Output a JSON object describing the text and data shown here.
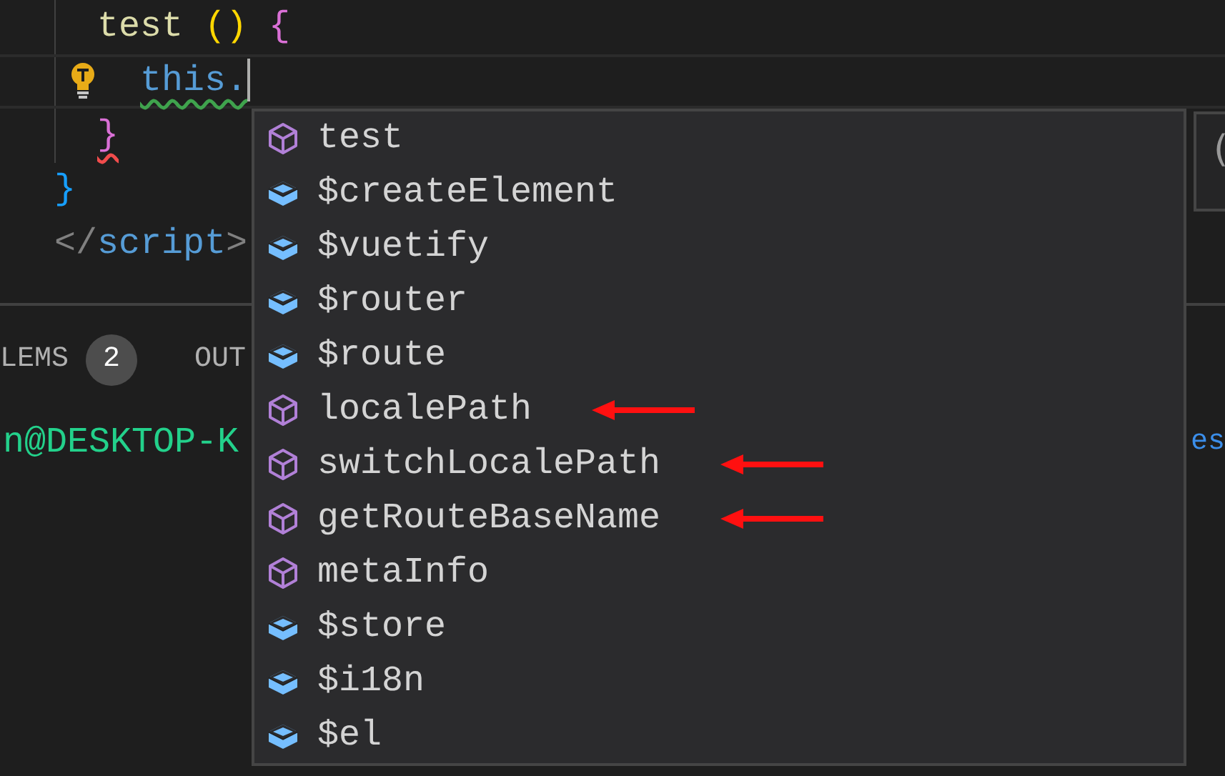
{
  "editor": {
    "lines": [
      {
        "children": [
          {
            "tokens": [
              {
                "text": "test",
                "kind": "function"
              },
              {
                "text": " ()",
                "kind": "bracket1"
              },
              {
                "text": " {",
                "kind": "bracket2"
              }
            ],
            "children": [
              {
                "current": true,
                "lightbulb": true,
                "cursor": true,
                "tokens": [
                  {
                    "text": "this.",
                    "kind": "keyword",
                    "warning": true
                  }
                ]
              }
            ]
          },
          {
            "tokens": [
              {
                "text": "}",
                "kind": "bracket2",
                "error": true
              }
            ]
          }
        ]
      },
      {
        "tokens": [
          {
            "text": "}",
            "kind": "bracket3"
          }
        ]
      },
      {
        "tokens": [
          {
            "text": "</",
            "kind": "tag"
          },
          {
            "text": "script",
            "kind": "keyword"
          },
          {
            "text": ">",
            "kind": "tag"
          }
        ]
      }
    ]
  },
  "panel": {
    "tabs": [
      {
        "label": "LEMS",
        "badge": "2"
      },
      {
        "label": "OUT"
      }
    ],
    "terminal": {
      "prompt": "n@DESKTOP-K",
      "right_text": "es"
    }
  },
  "suggestions": [
    {
      "label": "test",
      "kind": "property",
      "marked": false
    },
    {
      "label": "$createElement",
      "kind": "field",
      "marked": false
    },
    {
      "label": "$vuetify",
      "kind": "field",
      "marked": false
    },
    {
      "label": "$router",
      "kind": "field",
      "marked": false
    },
    {
      "label": "$route",
      "kind": "field",
      "marked": false
    },
    {
      "label": "localePath",
      "kind": "property",
      "marked": true
    },
    {
      "label": "switchLocalePath",
      "kind": "property",
      "marked": true
    },
    {
      "label": "getRouteBaseName",
      "kind": "property",
      "marked": true
    },
    {
      "label": "metaInfo",
      "kind": "property",
      "marked": false
    },
    {
      "label": "$store",
      "kind": "field",
      "marked": false
    },
    {
      "label": "$i18n",
      "kind": "field",
      "marked": false
    },
    {
      "label": "$el",
      "kind": "field",
      "marked": false
    }
  ],
  "details": {
    "text": "("
  }
}
